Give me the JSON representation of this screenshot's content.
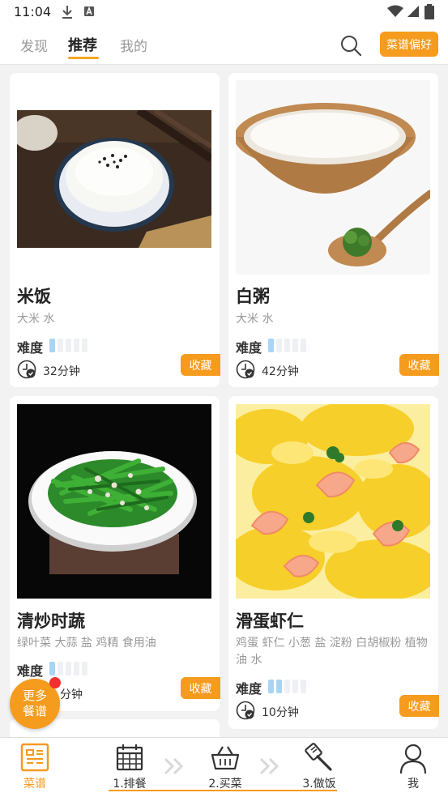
{
  "status_bar": {
    "time": "11:04"
  },
  "top_nav": {
    "tabs": [
      {
        "label": "发现",
        "active": false
      },
      {
        "label": "推荐",
        "active": true
      },
      {
        "label": "我的",
        "active": false
      }
    ],
    "preference_button": "菜谱偏好"
  },
  "recipes": [
    {
      "name": "米饭",
      "ingredients": "大米 水",
      "difficulty_label": "难度",
      "difficulty": 1,
      "difficulty_max": 5,
      "duration": "32分钟",
      "favorite_label": "收藏"
    },
    {
      "name": "白粥",
      "ingredients": "大米 水",
      "difficulty_label": "难度",
      "difficulty": 1,
      "difficulty_max": 5,
      "duration": "42分钟",
      "favorite_label": "收藏"
    },
    {
      "name": "清炒时蔬",
      "ingredients": "绿叶菜 大蒜 盐 鸡精 食用油",
      "difficulty_label": "难度",
      "difficulty": 1,
      "difficulty_max": 5,
      "duration": "分钟",
      "favorite_label": "收藏"
    },
    {
      "name": "滑蛋虾仁",
      "ingredients": "鸡蛋 虾仁 小葱 盐 淀粉 白胡椒粉 植物油 水",
      "difficulty_label": "难度",
      "difficulty": 2,
      "difficulty_max": 5,
      "duration": "10分钟",
      "favorite_label": "收藏"
    }
  ],
  "floating_button": {
    "line1": "更多",
    "line2": "餐谱"
  },
  "bottom_nav": {
    "items": [
      {
        "label": "菜谱",
        "icon": "recipe-icon",
        "active": true
      },
      {
        "label": "1.排餐",
        "icon": "calendar-icon",
        "active": false
      },
      {
        "label": "2.买菜",
        "icon": "basket-icon",
        "active": false
      },
      {
        "label": "3.做饭",
        "icon": "spatula-icon",
        "active": false
      },
      {
        "label": "我",
        "icon": "person-icon",
        "active": false
      }
    ]
  },
  "colors": {
    "accent": "#f59b1d",
    "difficulty_on": "#a8d4f5",
    "difficulty_off": "#eef0f4",
    "badge": "#f23030"
  }
}
